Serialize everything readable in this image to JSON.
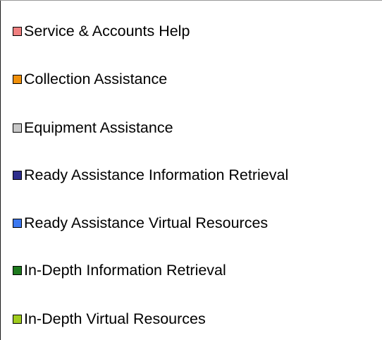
{
  "chart_data": {
    "type": "pie",
    "title": "",
    "legend_position": "right",
    "legend": [
      {
        "label": "Service & Accounts Help",
        "color": "#f08080"
      },
      {
        "label": "Collection Assistance",
        "color": "#f0900a"
      },
      {
        "label": "Equipment Assistance",
        "color": "#c8c8c8"
      },
      {
        "label": "Ready Assistance Information Retrieval",
        "color": "#2e2e8c"
      },
      {
        "label": "Ready Assistance Virtual Resources",
        "color": "#3c78f0"
      },
      {
        "label": "In-Depth Information Retrieval",
        "color": "#1e7a1e"
      },
      {
        "label": "In-Depth Virtual Resources",
        "color": "#a0cc1e"
      }
    ]
  }
}
